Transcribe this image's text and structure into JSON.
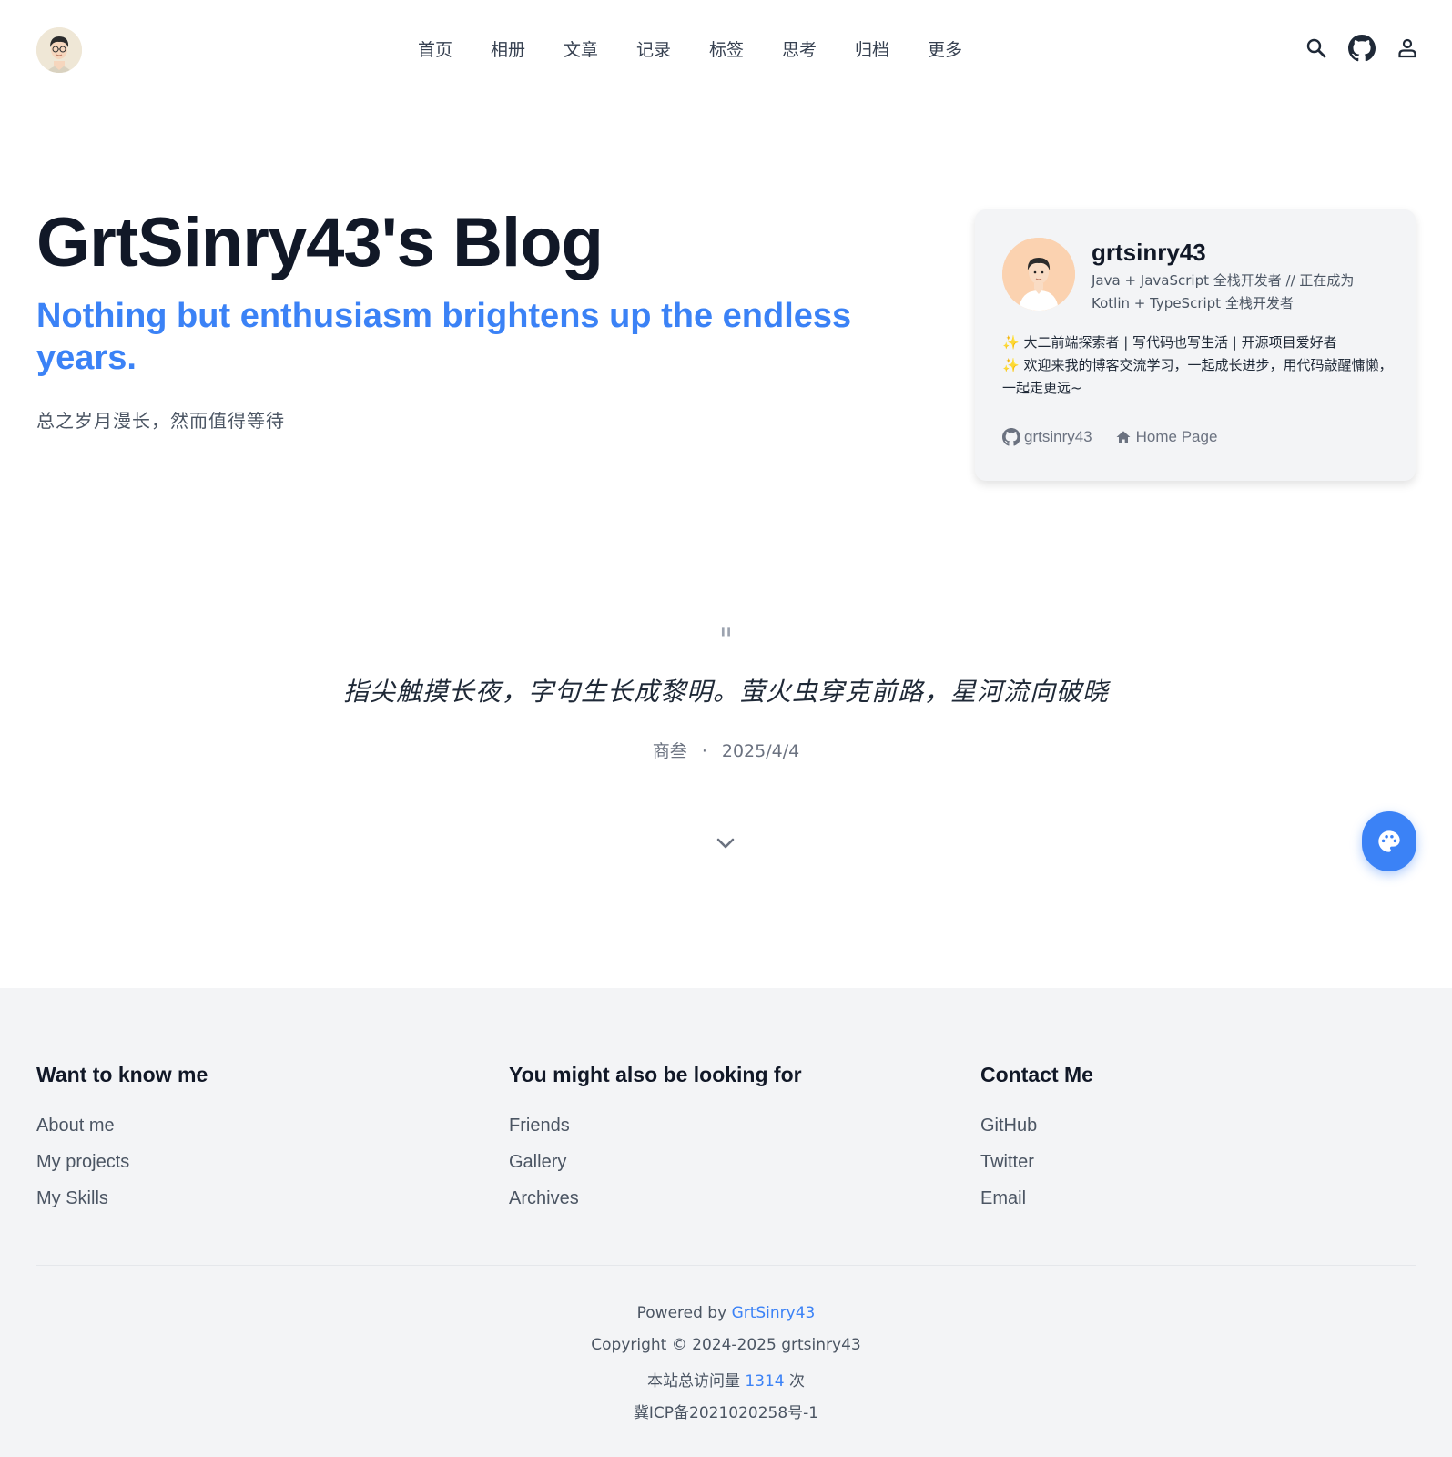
{
  "nav": {
    "items": [
      "首页",
      "相册",
      "文章",
      "记录",
      "标签",
      "思考",
      "归档",
      "更多"
    ]
  },
  "header_icons": [
    "search-icon",
    "github-icon",
    "user-icon"
  ],
  "hero": {
    "title": "GrtSinry43's Blog",
    "subtitle": "Nothing but enthusiasm brightens up the endless years.",
    "description": "总之岁月漫长，然而值得等待"
  },
  "profile": {
    "name": "grtsinry43",
    "role": "Java + JavaScript 全栈开发者 // 正在成为 Kotlin + TypeScript 全栈开发者",
    "bio_line1": "✨ 大二前端探索者 | 写代码也写生活 | 开源项目爱好者",
    "bio_line2": "✨ 欢迎来我的博客交流学习，一起成长进步，用代码敲醒慵懒，一起走更远~",
    "github_label": "grtsinry43",
    "homepage_label": "Home Page"
  },
  "quote": {
    "mark": "\"",
    "text": "指尖触摸长夜，字句生长成黎明。萤火虫穿克前路，星河流向破晓",
    "author": "商叁",
    "separator": "·",
    "date": "2025/4/4"
  },
  "footer": {
    "col1": {
      "title": "Want to know me",
      "links": [
        "About me",
        "My projects",
        "My Skills"
      ]
    },
    "col2": {
      "title": "You might also be looking for",
      "links": [
        "Friends",
        "Gallery",
        "Archives"
      ]
    },
    "col3": {
      "title": "Contact Me",
      "links": [
        "GitHub",
        "Twitter",
        "Email"
      ]
    },
    "powered_prefix": "Powered by",
    "powered_link": "GrtSinry43",
    "copyright": "Copyright © 2024-2025 grtsinry43",
    "visits_prefix": "本站总访问量",
    "visits_count": "1314",
    "visits_suffix": "次",
    "icp": "冀ICP备2021020258号-1"
  },
  "colors": {
    "accent": "#3b82f6",
    "footer_bg": "#f3f4f6",
    "card_bg": "#f3f4f6"
  }
}
